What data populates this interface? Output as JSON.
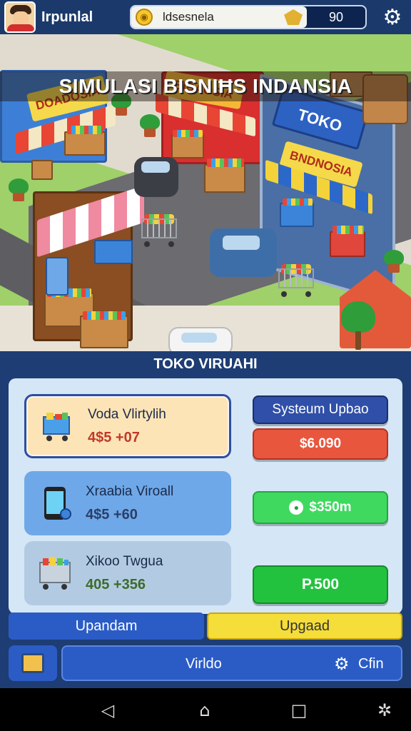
{
  "hud": {
    "player_name": "Irpunlal",
    "currency_label": "ldsesnela",
    "currency_count": "90"
  },
  "scene": {
    "title": "SIMULASI BISNIĦS INDANSIA",
    "sign_left": "DOADOSIA",
    "sign_center": "BIDAOSIA",
    "sign_right_top": "TOKO",
    "sign_right_bottom": "BNDNOSIA"
  },
  "panel": {
    "title": "TOKO VIRUAHI",
    "items": [
      {
        "name": "Voda Vlirtylih",
        "price": "4$5 +07",
        "icon": "shopping-cart-icon"
      },
      {
        "name": "Xraabia Viroall",
        "price": "4$5 +60",
        "icon": "smartphone-icon"
      },
      {
        "name": "Xikoo Twgua",
        "price": "405 +356",
        "icon": "shopping-cart-icon"
      }
    ],
    "buttons": {
      "system_upgrade": "Systeum Upbao",
      "price_1": "$6.090",
      "price_2": "$350m",
      "price_3": "P.500"
    },
    "tabs": {
      "left": "Upandam",
      "right": "Upgaad"
    },
    "bottom": {
      "main_label": "Virldo",
      "settings_label": "Cfin"
    }
  },
  "colors": {
    "hud_bg": "#1b3a6b",
    "panel_bg": "#1d3d74",
    "accent_yellow": "#f5dd3a",
    "accent_green": "#3fd95f",
    "accent_red": "#e8563d"
  }
}
